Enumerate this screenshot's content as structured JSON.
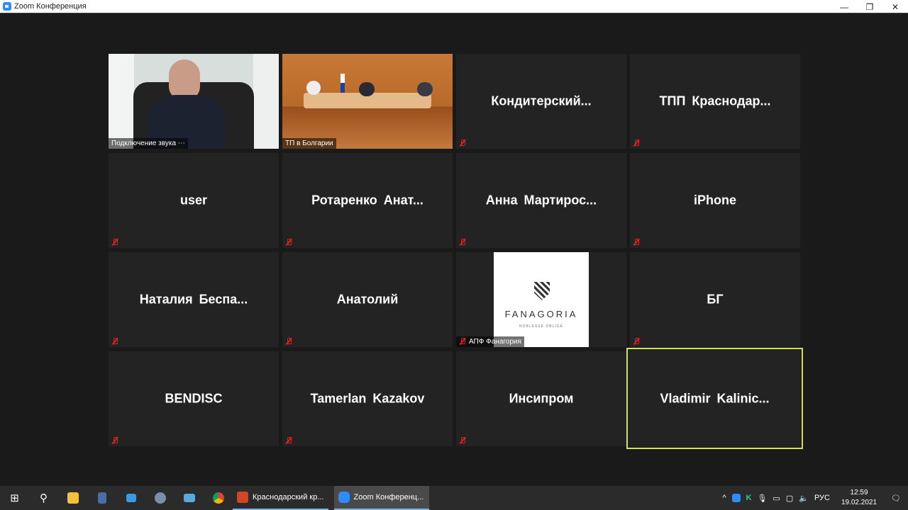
{
  "window": {
    "title": "Zoom Конференция",
    "minimize": "—",
    "maximize": "❐",
    "close": "✕"
  },
  "tiles": [
    {
      "type": "video",
      "label": "Подключение звука ⋯"
    },
    {
      "type": "video",
      "label": "ТП в Болгарии"
    },
    {
      "type": "name",
      "name": "Кондитерский..."
    },
    {
      "type": "name",
      "name": "ТПП Краснодар..."
    },
    {
      "type": "name",
      "name": "user"
    },
    {
      "type": "name",
      "name": "Ротаренко Анат..."
    },
    {
      "type": "name",
      "name": "Анна Мартирос..."
    },
    {
      "type": "name",
      "name": "iPhone"
    },
    {
      "type": "name",
      "name": "Наталия Беспа..."
    },
    {
      "type": "name",
      "name": "Анатолий"
    },
    {
      "type": "image",
      "label": "АПФ Фанагория",
      "logo_text": "FANAGORIA",
      "logo_sub": "NOBLESSE OBLIGE"
    },
    {
      "type": "name",
      "name": "БГ"
    },
    {
      "type": "name",
      "name": "BENDISC"
    },
    {
      "type": "name",
      "name": "Tamerlan Kazakov"
    },
    {
      "type": "name",
      "name": "Инсипром"
    },
    {
      "type": "name",
      "name": "Vladimir Kalinic...",
      "active": true
    }
  ],
  "taskbar": {
    "apps": [
      {
        "label": "Краснодарский кр..."
      },
      {
        "label": "Zoom Конференц..."
      }
    ],
    "lang": "РУС",
    "time": "12:59",
    "date": "19.02.2021"
  },
  "colors": {
    "active_speaker": "#d4e157",
    "muted": "#e02020"
  }
}
